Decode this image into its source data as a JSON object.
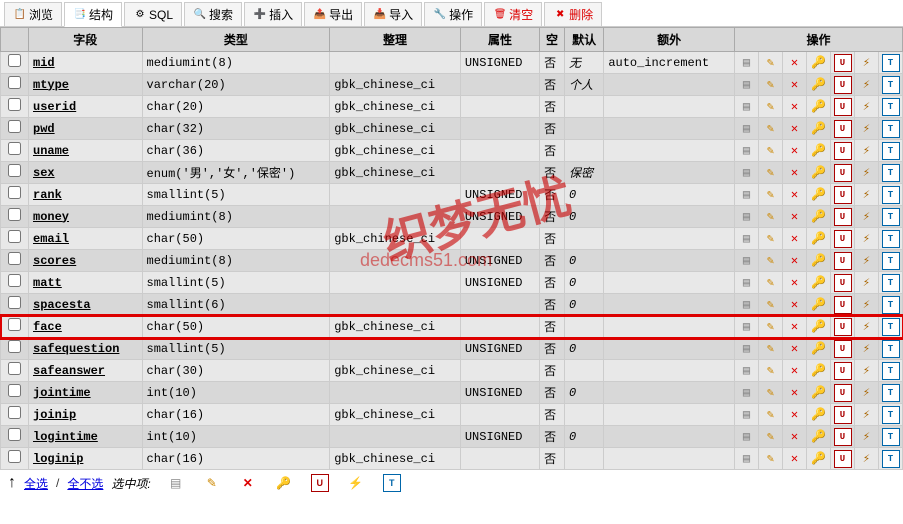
{
  "tabs": [
    {
      "label": "浏览",
      "icon": "📋"
    },
    {
      "label": "结构",
      "icon": "📑",
      "active": true
    },
    {
      "label": "SQL",
      "icon": "⚙"
    },
    {
      "label": "搜索",
      "icon": "🔍"
    },
    {
      "label": "插入",
      "icon": "➕"
    },
    {
      "label": "导出",
      "icon": "📤"
    },
    {
      "label": "导入",
      "icon": "📥"
    },
    {
      "label": "操作",
      "icon": "🔧"
    },
    {
      "label": "清空",
      "icon": "🗑",
      "danger": true
    },
    {
      "label": "删除",
      "icon": "✖",
      "danger": true
    }
  ],
  "headers": {
    "field": "字段",
    "type": "类型",
    "collation": "整理",
    "attr": "属性",
    "null": "空",
    "default": "默认",
    "extra": "额外",
    "action": "操作"
  },
  "rows": [
    {
      "field": "mid",
      "type": "mediumint(8)",
      "collation": "",
      "attr": "UNSIGNED",
      "null": "否",
      "default": "无",
      "extra": "auto_increment"
    },
    {
      "field": "mtype",
      "type": "varchar(20)",
      "collation": "gbk_chinese_ci",
      "attr": "",
      "null": "否",
      "default": "个人",
      "extra": ""
    },
    {
      "field": "userid",
      "type": "char(20)",
      "collation": "gbk_chinese_ci",
      "attr": "",
      "null": "否",
      "default": "",
      "extra": ""
    },
    {
      "field": "pwd",
      "type": "char(32)",
      "collation": "gbk_chinese_ci",
      "attr": "",
      "null": "否",
      "default": "",
      "extra": ""
    },
    {
      "field": "uname",
      "type": "char(36)",
      "collation": "gbk_chinese_ci",
      "attr": "",
      "null": "否",
      "default": "",
      "extra": ""
    },
    {
      "field": "sex",
      "type": "enum('男','女','保密')",
      "collation": "gbk_chinese_ci",
      "attr": "",
      "null": "否",
      "default": "保密",
      "extra": ""
    },
    {
      "field": "rank",
      "type": "smallint(5)",
      "collation": "",
      "attr": "UNSIGNED",
      "null": "否",
      "default": "0",
      "extra": ""
    },
    {
      "field": "money",
      "type": "mediumint(8)",
      "collation": "",
      "attr": "UNSIGNED",
      "null": "否",
      "default": "0",
      "extra": ""
    },
    {
      "field": "email",
      "type": "char(50)",
      "collation": "gbk_chinese_ci",
      "attr": "",
      "null": "否",
      "default": "",
      "extra": ""
    },
    {
      "field": "scores",
      "type": "mediumint(8)",
      "collation": "",
      "attr": "UNSIGNED",
      "null": "否",
      "default": "0",
      "extra": ""
    },
    {
      "field": "matt",
      "type": "smallint(5)",
      "collation": "",
      "attr": "UNSIGNED",
      "null": "否",
      "default": "0",
      "extra": ""
    },
    {
      "field": "spacesta",
      "type": "smallint(6)",
      "collation": "",
      "attr": "",
      "null": "否",
      "default": "0",
      "extra": ""
    },
    {
      "field": "face",
      "type": "char(50)",
      "collation": "gbk_chinese_ci",
      "attr": "",
      "null": "否",
      "default": "",
      "extra": "",
      "highlighted": true
    },
    {
      "field": "safequestion",
      "type": "smallint(5)",
      "collation": "",
      "attr": "UNSIGNED",
      "null": "否",
      "default": "0",
      "extra": ""
    },
    {
      "field": "safeanswer",
      "type": "char(30)",
      "collation": "gbk_chinese_ci",
      "attr": "",
      "null": "否",
      "default": "",
      "extra": ""
    },
    {
      "field": "jointime",
      "type": "int(10)",
      "collation": "",
      "attr": "UNSIGNED",
      "null": "否",
      "default": "0",
      "extra": ""
    },
    {
      "field": "joinip",
      "type": "char(16)",
      "collation": "gbk_chinese_ci",
      "attr": "",
      "null": "否",
      "default": "",
      "extra": ""
    },
    {
      "field": "logintime",
      "type": "int(10)",
      "collation": "",
      "attr": "UNSIGNED",
      "null": "否",
      "default": "0",
      "extra": ""
    },
    {
      "field": "loginip",
      "type": "char(16)",
      "collation": "gbk_chinese_ci",
      "attr": "",
      "null": "否",
      "default": "",
      "extra": ""
    }
  ],
  "footer": {
    "select_all": "全选",
    "unselect_all": "全不选",
    "with_selected": "选中项:"
  },
  "watermark": "织梦无忧",
  "watermark2": "dedecms51.com"
}
